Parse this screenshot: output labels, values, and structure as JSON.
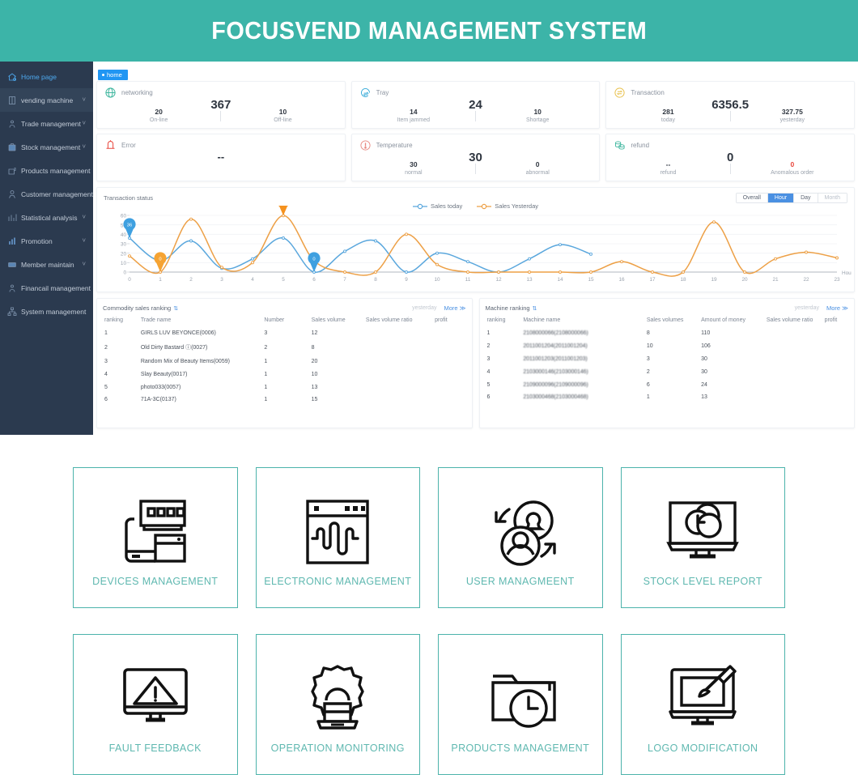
{
  "header": {
    "title": "FOCUSVEND MANAGEMENT SYSTEM",
    "bg": "#3cb4a8"
  },
  "sidebar": {
    "items": [
      {
        "label": "Home page",
        "icon": "home-icon",
        "active": true,
        "caret": false
      },
      {
        "label": "vending machine",
        "icon": "machine-icon",
        "active": false,
        "caret": true
      },
      {
        "label": "Trade management",
        "icon": "trade-icon",
        "active": false,
        "caret": true
      },
      {
        "label": "Stock management",
        "icon": "stock-icon",
        "active": false,
        "caret": true
      },
      {
        "label": "Products management",
        "icon": "products-icon",
        "active": false,
        "caret": false
      },
      {
        "label": "Customer management",
        "icon": "customer-icon",
        "active": false,
        "caret": false
      },
      {
        "label": "Statistical analysis",
        "icon": "stats-icon",
        "active": false,
        "caret": true
      },
      {
        "label": "Promotion",
        "icon": "promotion-icon",
        "active": false,
        "caret": true
      },
      {
        "label": "Member maintain",
        "icon": "member-icon",
        "active": false,
        "caret": true
      },
      {
        "label": "Financail management",
        "icon": "finance-icon",
        "active": false,
        "caret": false
      },
      {
        "label": "System management",
        "icon": "system-icon",
        "active": false,
        "caret": false
      }
    ]
  },
  "tab": {
    "label": "home"
  },
  "stats": [
    {
      "title": "networking",
      "icon": "globe-icon",
      "main": "367",
      "left": {
        "value": "20",
        "label": "On-line"
      },
      "right": {
        "value": "10",
        "label": "Off-line"
      }
    },
    {
      "title": "Tray",
      "icon": "tray-icon",
      "main": "24",
      "left": {
        "value": "14",
        "label": "Item jammed"
      },
      "right": {
        "value": "10",
        "label": "Shortage"
      }
    },
    {
      "title": "Transaction",
      "icon": "transaction-icon",
      "main": "6356.5",
      "left": {
        "value": "281",
        "label": "today"
      },
      "right": {
        "value": "327.75",
        "label": "yesterday"
      }
    },
    {
      "title": "Error",
      "icon": "error-icon",
      "main": "--",
      "left": {
        "value": "",
        "label": ""
      },
      "right": {
        "value": "",
        "label": ""
      }
    },
    {
      "title": "Temperature",
      "icon": "temperature-icon",
      "main": "30",
      "left": {
        "value": "30",
        "label": "normal"
      },
      "right": {
        "value": "0",
        "label": "abnormal"
      }
    },
    {
      "title": "refund",
      "icon": "refund-icon",
      "main": "0",
      "left": {
        "value": "--",
        "label": "refund"
      },
      "right": {
        "value": "0",
        "label": "Anomalous order",
        "red": true
      }
    }
  ],
  "chart_panel": {
    "title": "Transaction status",
    "segments": [
      {
        "label": "Overall",
        "state": "normal"
      },
      {
        "label": "Hour",
        "state": "active"
      },
      {
        "label": "Day",
        "state": "normal"
      },
      {
        "label": "Month",
        "state": "muted"
      }
    ]
  },
  "chart_data": {
    "type": "line",
    "title": "Transaction status",
    "xlabel": "Hour",
    "ylabel": "",
    "xlim": [
      0,
      23
    ],
    "ylim": [
      0,
      60
    ],
    "yticks": [
      0,
      10,
      20,
      30,
      40,
      50,
      60
    ],
    "xticks": [
      0,
      1,
      2,
      3,
      4,
      5,
      6,
      7,
      8,
      9,
      10,
      11,
      12,
      13,
      14,
      15,
      16,
      17,
      18,
      19,
      20,
      21,
      22,
      23
    ],
    "grid": true,
    "legend_position": "top-center",
    "legend": [
      "Sales today",
      "Sales Yesterday"
    ],
    "series": [
      {
        "name": "Sales today",
        "color": "#5aa7dd",
        "x": [
          0,
          1,
          2,
          3,
          4,
          5,
          6,
          7,
          8,
          9,
          10,
          11,
          12,
          13,
          14,
          15
        ],
        "values": [
          36,
          12,
          33,
          4,
          14,
          36,
          0,
          22,
          33,
          0,
          20,
          11,
          0,
          14,
          29,
          19
        ]
      },
      {
        "name": "Sales Yesterday",
        "color": "#eda046",
        "x": [
          0,
          1,
          2,
          3,
          4,
          5,
          6,
          7,
          8,
          9,
          10,
          11,
          12,
          13,
          14,
          15,
          16,
          17,
          18,
          19,
          20,
          21,
          22,
          23
        ],
        "values": [
          17,
          0,
          56,
          5,
          10,
          59.75,
          12,
          0,
          0,
          40,
          8,
          0,
          0,
          0,
          0,
          0,
          11,
          0,
          0,
          53,
          0,
          14,
          21,
          15
        ]
      }
    ],
    "annotations": [
      {
        "series": "Sales today",
        "x": 0,
        "value": "36",
        "color": "#3fa0e0"
      },
      {
        "series": "Sales Yesterday",
        "x": 1,
        "value": "0",
        "color": "#f5a333"
      },
      {
        "series": "Sales Yesterday",
        "x": 5,
        "value": "59.75",
        "color": "#f5921e"
      },
      {
        "series": "Sales today",
        "x": 6,
        "value": "0",
        "color": "#3fa0e0"
      }
    ]
  },
  "commodity_ranking": {
    "title": "Commodity sales ranking",
    "when": "yesterday",
    "more": "More ≫",
    "columns": [
      "ranking",
      "Trade name",
      "Number",
      "Sales volume",
      "Sales volume ratio",
      "profit"
    ],
    "rows": [
      [
        "1",
        "GIRLS LUV BEYONCE(0006)",
        "3",
        "12",
        "",
        ""
      ],
      [
        "2",
        "Old Dirty Bastard ⓘ(0027)",
        "2",
        "8",
        "",
        ""
      ],
      [
        "3",
        "Random Mix of Beauty Items(0059)",
        "1",
        "20",
        "",
        ""
      ],
      [
        "4",
        "Slay Beauty(0017)",
        "1",
        "10",
        "",
        ""
      ],
      [
        "5",
        "photo033(0057)",
        "1",
        "13",
        "",
        ""
      ],
      [
        "6",
        "71A-3C(0137)",
        "1",
        "15",
        "",
        ""
      ]
    ]
  },
  "machine_ranking": {
    "title": "Machine ranking",
    "when": "yesterday",
    "more": "More ≫",
    "columns": [
      "ranking",
      "Machine name",
      "Sales volumes",
      "Amount of money",
      "Sales volume ratio",
      "profit"
    ],
    "rows": [
      [
        "1",
        "2108000066(2108000066)",
        "8",
        "110",
        "",
        ""
      ],
      [
        "2",
        "2011001204(2011001204)",
        "10",
        "106",
        "",
        ""
      ],
      [
        "3",
        "2011001203(2011001203)",
        "3",
        "30",
        "",
        ""
      ],
      [
        "4",
        "2103000146(2103000146)",
        "2",
        "30",
        "",
        ""
      ],
      [
        "5",
        "2109000096(2109000096)",
        "6",
        "24",
        "",
        ""
      ],
      [
        "6",
        "2103000468(2103000468)",
        "1",
        "13",
        "",
        ""
      ]
    ]
  },
  "feature_cards": [
    {
      "label": "DEVICES MANAGEMENT",
      "icon": "devices-icon"
    },
    {
      "label": "ELECTRONIC MANAGEMENT",
      "icon": "waveform-window-icon"
    },
    {
      "label": "USER MANAGMEENT",
      "icon": "users-cycle-icon"
    },
    {
      "label": "STOCK LEVEL REPORT",
      "icon": "monitor-chart-icon"
    },
    {
      "label": "FAULT FEEDBACK",
      "icon": "monitor-warning-icon"
    },
    {
      "label": "OPERATION MONITORING",
      "icon": "gear-laptop-icon"
    },
    {
      "label": "PRODUCTS MANAGEMENT",
      "icon": "folder-clock-icon"
    },
    {
      "label": "LOGO MODIFICATION",
      "icon": "monitor-brush-icon"
    }
  ],
  "theme": {
    "teal": "#4cb3ab",
    "label_teal": "#5fb8b0",
    "blue": "#4a90e2",
    "navy": "#2b3a4f"
  }
}
